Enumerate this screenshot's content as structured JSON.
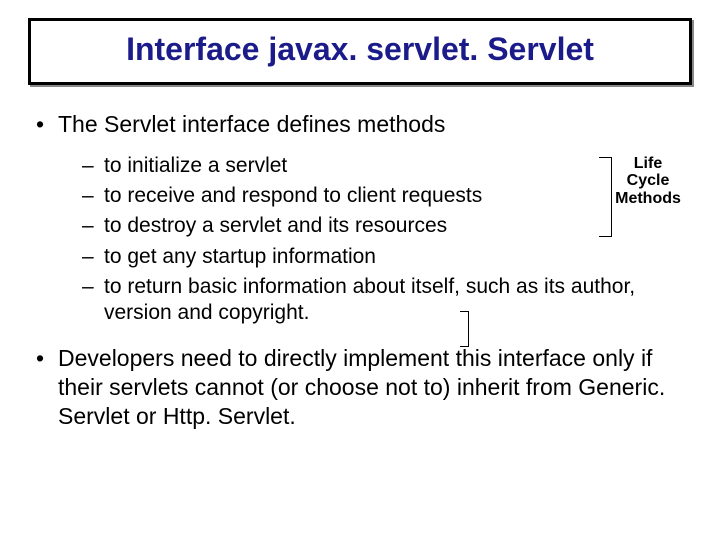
{
  "title": "Interface javax. servlet. Servlet",
  "bullet_intro": "The Servlet interface defines methods",
  "sub": {
    "s1": "to initialize a servlet",
    "s2": " to receive and respond to client requests",
    "s3": " to destroy a servlet and its resources",
    "s4": " to get any startup information",
    "s5": " to return basic information about itself, such as its author, version and copyright."
  },
  "annotation": {
    "l1": "Life",
    "l2": "Cycle",
    "l3": "Methods"
  },
  "bullet_dev": "Developers need to directly implement this interface only if their servlets cannot (or choose not to) inherit from Generic. Servlet or Http. Servlet."
}
